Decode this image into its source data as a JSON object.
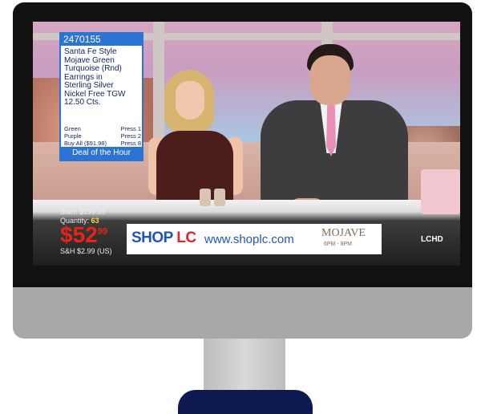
{
  "item": {
    "id": "2470155",
    "description_lines": [
      "Santa Fe Style",
      "Mojave Green",
      "Turquoise (Rnd)",
      "Earrings in",
      "Sterling Silver",
      "Nickel Free TGW",
      "12.50 Cts."
    ],
    "options": [
      {
        "name": "Green",
        "action": "Press 1"
      },
      {
        "name": "Purple",
        "action": "Press 2"
      },
      {
        "name": "Buy All ($91.98)",
        "action": "Press 8"
      }
    ],
    "deal_label": "Deal of the Hour"
  },
  "pricing": {
    "start_label": "Start: $199.99",
    "quantity_label": "Quantity:",
    "quantity_value": "63",
    "price": "$52",
    "price_cents": "99",
    "sh_label": "S&H $2.99 (US)"
  },
  "brand": {
    "shop": "SHOP",
    "lc": "LC",
    "url": "www.shoplc.com",
    "mojave_title": "MOJAVE",
    "mojave_time": "6PM - 8PM"
  },
  "channel_bug": "LCHD",
  "colors": {
    "accent_blue": "#2b74d6",
    "brand_blue": "#1e56b8",
    "brand_red": "#e1262a",
    "price_red": "#e8231d",
    "monitor_base": "#0d1a52"
  }
}
